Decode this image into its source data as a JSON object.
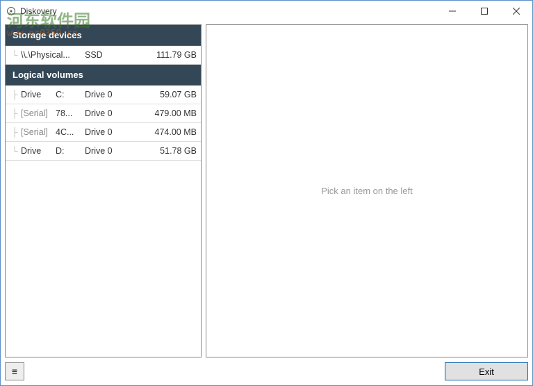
{
  "titlebar": {
    "title": "Diskovery"
  },
  "sections": {
    "storage": {
      "title": "Storage devices"
    },
    "volumes": {
      "title": "Logical volumes"
    }
  },
  "devices": [
    {
      "name": "\\\\.\\Physical...",
      "type": "SSD",
      "size": "111.79 GB"
    }
  ],
  "volumes": [
    {
      "kind": "Drive",
      "id": "C:",
      "disk": "Drive 0",
      "size": "59.07 GB",
      "muted": false
    },
    {
      "kind": "[Serial]",
      "id": "78...",
      "disk": "Drive 0",
      "size": "479.00 MB",
      "muted": true
    },
    {
      "kind": "[Serial]",
      "id": "4C...",
      "disk": "Drive 0",
      "size": "474.00 MB",
      "muted": true
    },
    {
      "kind": "Drive",
      "id": "D:",
      "disk": "Drive 0",
      "size": "51.78 GB",
      "muted": false
    }
  ],
  "right": {
    "placeholder": "Pick an item on the left"
  },
  "footer": {
    "menu_glyph": "≡",
    "exit_label": "Exit"
  },
  "watermark": {
    "line1": "河东软件园",
    "line2": "www.pc0359.cn"
  }
}
